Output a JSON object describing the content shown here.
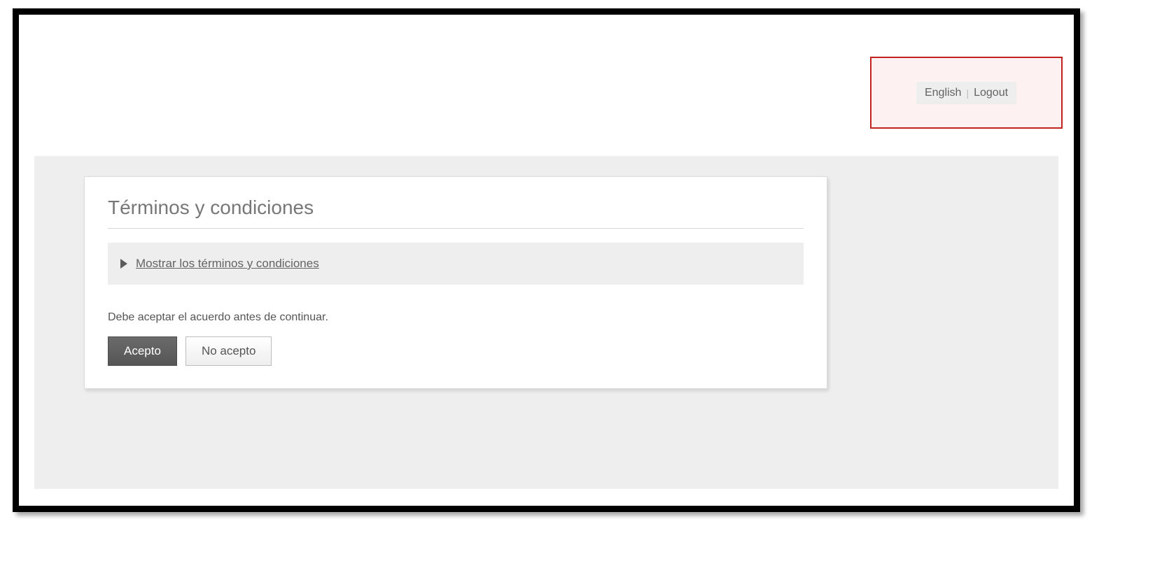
{
  "header": {
    "language_link": "English",
    "logout_link": "Logout"
  },
  "card": {
    "title": "Términos y condiciones",
    "expand_label": "Mostrar los términos y condiciones",
    "instruction": "Debe aceptar el acuerdo antes de continuar.",
    "accept_label": "Acepto",
    "decline_label": "No acepto"
  }
}
